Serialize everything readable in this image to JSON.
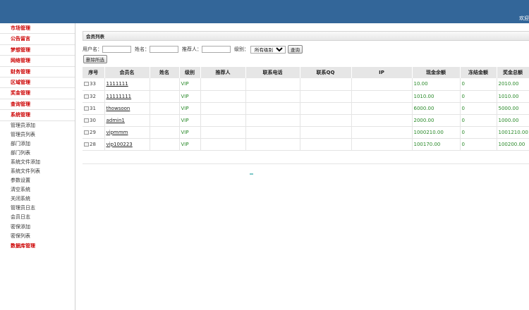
{
  "header": {
    "welcome": "欢迎"
  },
  "sidebar": {
    "groups": [
      "市场管理",
      "公告留言",
      "梦想管理",
      "网络管理",
      "财务管理",
      "区域管理",
      "奖金管理",
      "查询管理",
      "系统管理"
    ],
    "system_items": [
      "管理员添加",
      "管理员列表",
      "部门添加",
      "部门列表",
      "系统文件添加",
      "系统文件列表",
      "参数设置",
      "清空系统",
      "关闭系统",
      "管理员日志",
      "会员日志",
      "密保添加",
      "密保列表"
    ],
    "last_group": "数据库管理"
  },
  "panel": {
    "title": "会员列表"
  },
  "search": {
    "username_label": "用户名：",
    "name_label": "姓名：",
    "referrer_label": "推荐人：",
    "level_label": "级别：",
    "level_selected": "所有级别",
    "query_button": "查询"
  },
  "toolbar": {
    "delete_selected": "删除所选"
  },
  "table": {
    "columns": [
      "序号",
      "会员名",
      "姓名",
      "级别",
      "推荐人",
      "联系电话",
      "联系QQ",
      "IP",
      "现金余额",
      "冻结金额",
      "奖金总额"
    ],
    "rows": [
      {
        "id": "33",
        "username": "1111111",
        "level": "VIP",
        "cash": "10.00",
        "frozen": "0",
        "bonus": "2010.00"
      },
      {
        "id": "32",
        "username": "11111111",
        "level": "VIP",
        "cash": "1010.00",
        "frozen": "0",
        "bonus": "1010.00"
      },
      {
        "id": "31",
        "username": "thowsoon",
        "level": "VIP",
        "cash": "6000.00",
        "frozen": "0",
        "bonus": "5000.00"
      },
      {
        "id": "30",
        "username": "admin1",
        "level": "VIP",
        "cash": "2000.00",
        "frozen": "0",
        "bonus": "1000.00"
      },
      {
        "id": "29",
        "username": "vipmmm",
        "level": "VIP",
        "cash": "1000210.00",
        "frozen": "0",
        "bonus": "1001210.00"
      },
      {
        "id": "28",
        "username": "vip100223",
        "level": "VIP",
        "cash": "100170.00",
        "frozen": "0",
        "bonus": "100200.00"
      }
    ]
  },
  "colors": {
    "topbar": "#336699",
    "menu_group_text": "#cc0000",
    "money_text": "#2a8a2a"
  }
}
